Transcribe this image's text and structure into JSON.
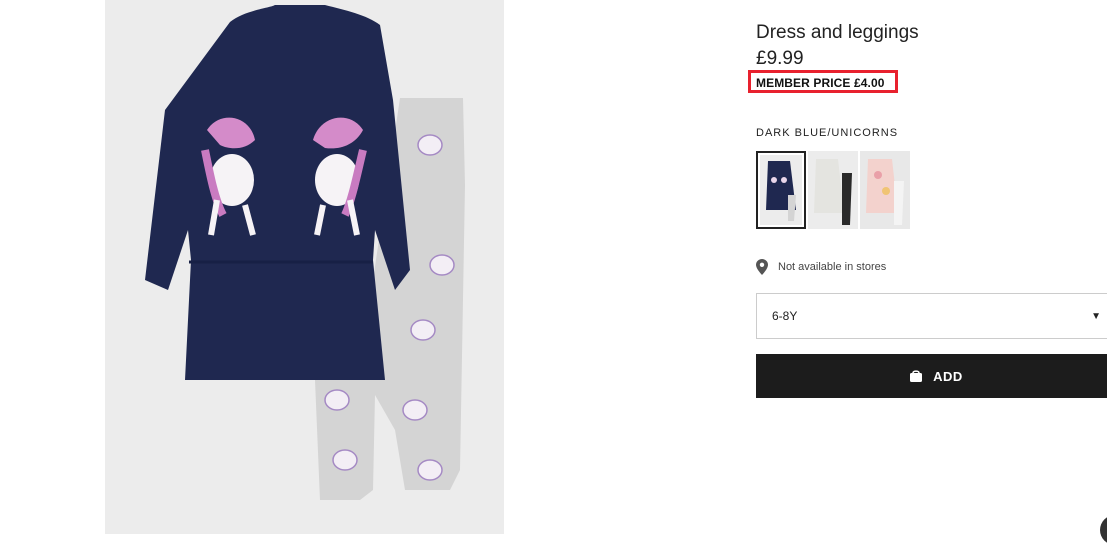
{
  "product": {
    "title": "Dress and leggings",
    "price": "£9.99",
    "member_price": "MEMBER PRICE £4.00",
    "image_icon": "product-photo-dress-and-leggings-unicorn"
  },
  "colors": {
    "selected_name": "DARK BLUE/UNICORNS",
    "swatches": [
      {
        "name": "dark-blue-unicorns",
        "selected": true
      },
      {
        "name": "light-grey-black",
        "selected": false
      },
      {
        "name": "light-pink-floral",
        "selected": false
      }
    ]
  },
  "availability": {
    "icon": "location-pin-icon",
    "text": "Not available in stores"
  },
  "size": {
    "selected": "6-8Y"
  },
  "add_button": {
    "label": "ADD",
    "icon": "shopping-bag-icon"
  },
  "theme": {
    "highlight": "#e8212e",
    "button_bg": "#1c1c1c",
    "navy": "#1f2850"
  }
}
